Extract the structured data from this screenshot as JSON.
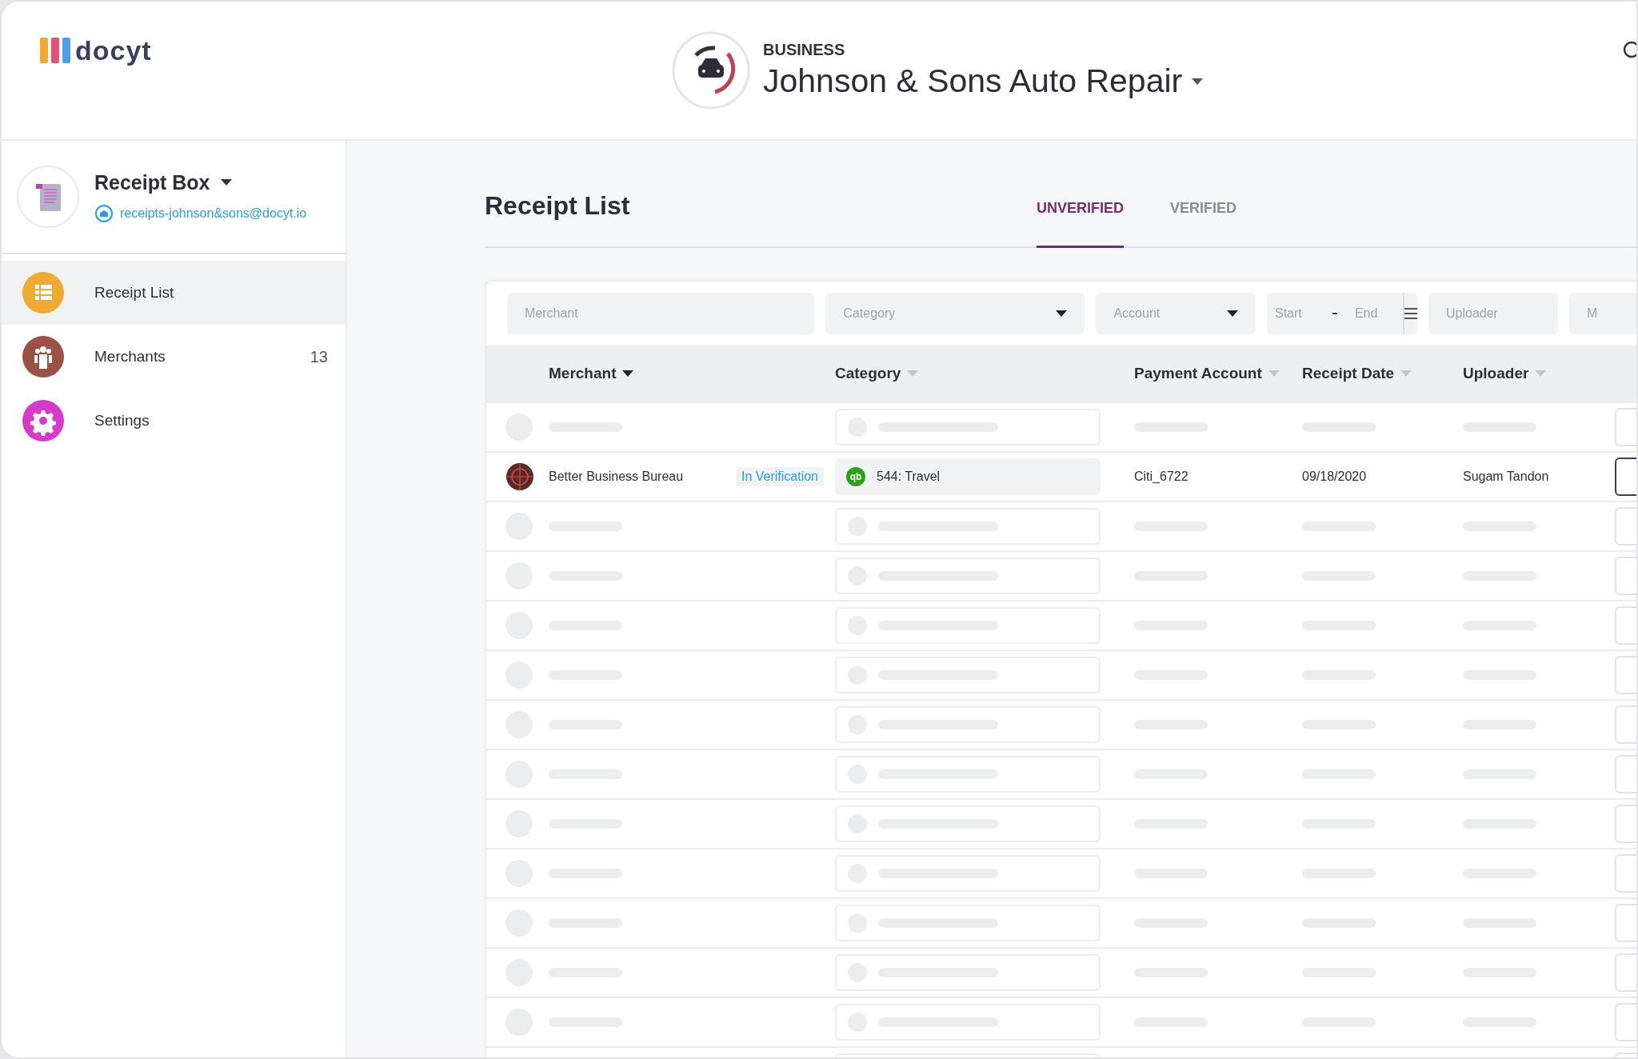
{
  "logo": {
    "text": "docyt"
  },
  "business": {
    "label": "BUSINESS",
    "name": "Johnson & Sons Auto Repair"
  },
  "sidebar": {
    "title": "Receipt Box",
    "email": "receipts-johnson&sons@docyt.io",
    "items": [
      {
        "label": "Receipt List",
        "kind": "list",
        "color": "#eeaa33",
        "selected": true
      },
      {
        "label": "Merchants",
        "kind": "people",
        "color": "#9a5247",
        "count": "13",
        "selected": false
      },
      {
        "label": "Settings",
        "kind": "gear",
        "color": "#d63ac8",
        "selected": false
      }
    ]
  },
  "page": {
    "title": "Receipt List"
  },
  "tabs": [
    {
      "label": "UNVERIFIED",
      "selected": true
    },
    {
      "label": "VERIFIED",
      "selected": false
    }
  ],
  "filters": [
    {
      "kind": "text",
      "placeholder": "Merchant"
    },
    {
      "kind": "select",
      "placeholder": "Category"
    },
    {
      "kind": "select",
      "placeholder": "Account"
    },
    {
      "kind": "range",
      "fields": [
        {
          "placeholder": "Start"
        },
        {
          "placeholder": "End"
        }
      ]
    },
    {
      "kind": "text",
      "placeholder": "Uploader"
    },
    {
      "kind": "text",
      "placeholder": "M"
    }
  ],
  "columns": [
    {
      "label": "Merchant",
      "sorted": true
    },
    {
      "label": "Category",
      "sorted": false
    },
    {
      "label": "Payment Account",
      "sorted": false
    },
    {
      "label": "Receipt Date",
      "sorted": false
    },
    {
      "label": "Uploader",
      "sorted": false
    }
  ],
  "rows": [
    {
      "kind": "skeleton"
    },
    {
      "kind": "receipt",
      "merchant": "Better Business Bureau",
      "status": "In Verification",
      "source": "qb",
      "category": "544: Travel",
      "account": "Citi_6722",
      "date": "09/18/2020",
      "uploader": "Sugam Tandon"
    },
    {
      "kind": "skeleton"
    },
    {
      "kind": "skeleton"
    },
    {
      "kind": "skeleton"
    },
    {
      "kind": "skeleton"
    },
    {
      "kind": "skeleton"
    },
    {
      "kind": "skeleton"
    },
    {
      "kind": "skeleton"
    },
    {
      "kind": "skeleton"
    },
    {
      "kind": "skeleton"
    },
    {
      "kind": "skeleton"
    },
    {
      "kind": "skeleton"
    },
    {
      "kind": "skeleton"
    }
  ]
}
